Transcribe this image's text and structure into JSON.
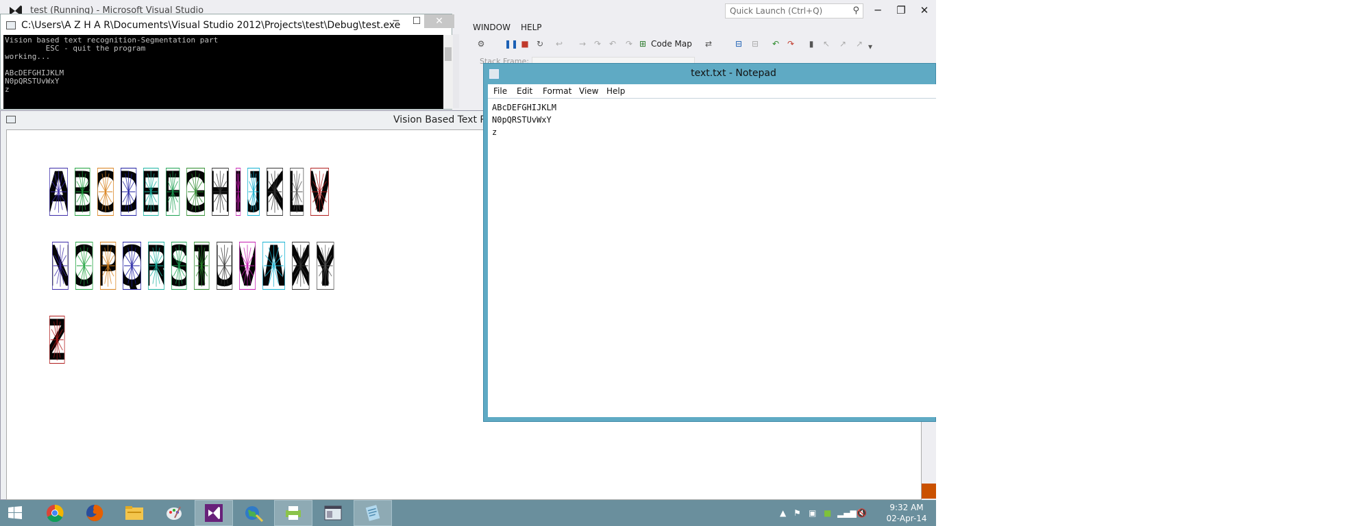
{
  "visual_studio": {
    "title": "test (Running) - Microsoft Visual Studio",
    "quick_launch_placeholder": "Quick Launch (Ctrl+Q)",
    "menu": {
      "window": "WINDOW",
      "help": "HELP"
    },
    "toolbar": {
      "code_map": "Code Map"
    },
    "stack_frame_label": "Stack Frame:",
    "window_controls": {
      "minimize": "─",
      "restore": "❐",
      "close": "✕"
    }
  },
  "console": {
    "title": "C:\\Users\\A Z H A R\\Documents\\Visual Studio 2012\\Projects\\test\\Debug\\test.exe",
    "lines": [
      "Vision based text recognition-Segmentation part",
      "         ESC - quit the program",
      "working...",
      "",
      "ABcDEFGHIJKLM",
      "N0pQRSTUvWxY",
      "z"
    ],
    "controls": {
      "minimize": "─",
      "maximize": "☐",
      "close": "✕"
    }
  },
  "vision_window": {
    "title": "Vision Based Text Re",
    "rows": [
      [
        "A",
        "B",
        "C",
        "D",
        "E",
        "F",
        "G",
        "H",
        "I",
        "J",
        "K",
        "L",
        "M"
      ],
      [
        "N",
        "O",
        "P",
        "Q",
        "R",
        "S",
        "T",
        "U",
        "V",
        "W",
        "X",
        "Y"
      ],
      [
        "Z"
      ]
    ],
    "box_colors": [
      "#3a2aa8",
      "#1aa03a",
      "#d8801a",
      "#1a1aa0",
      "#17b1a0",
      "#1aa050",
      "#2a8a2a",
      "#333",
      "#c41ab0",
      "#10b0d0",
      "#333",
      "#555",
      "#b01a1a"
    ]
  },
  "notepad": {
    "title": "text.txt - Notepad",
    "menu": [
      "File",
      "Edit",
      "Format",
      "View",
      "Help"
    ],
    "content": "ABcDEFGHIJKLM\nN0pQRSTUvWxY\nz"
  },
  "taskbar": {
    "apps": [
      "start-icon",
      "chrome-icon",
      "firefox-icon",
      "file-explorer-icon",
      "paint-icon",
      "visual-studio-icon",
      "globe-app-icon",
      "printer-app-icon",
      "window-app-icon",
      "notepad-icon"
    ],
    "time": "9:32 AM",
    "date": "02-Apr-14"
  }
}
